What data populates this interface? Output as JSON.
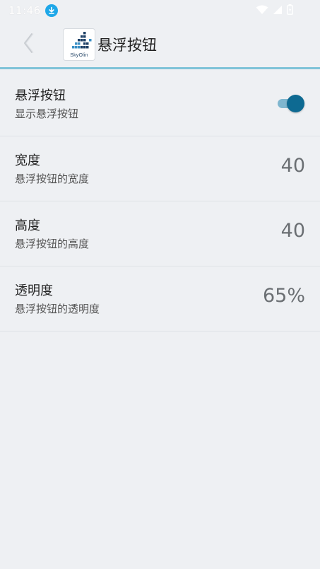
{
  "status_bar": {
    "time": "11:46",
    "icons": [
      "download-icon",
      "wifi-icon",
      "signal-icon",
      "battery-icon"
    ]
  },
  "header": {
    "title": "悬浮按钮",
    "logo_text": "SkyOlin",
    "back_icon": "chevron-left-icon"
  },
  "colors": {
    "accent": "#0e6a92",
    "accent_light": "#7fb6cf",
    "header_border": "#7fc3d8",
    "background": "#eef0f3"
  },
  "settings": [
    {
      "title": "悬浮按钮",
      "summary": "显示悬浮按钮",
      "enabled": true
    },
    {
      "title": "宽度",
      "summary": "悬浮按钮的宽度",
      "value": "40"
    },
    {
      "title": "高度",
      "summary": "悬浮按钮的高度",
      "value": "40"
    },
    {
      "title": "透明度",
      "summary": "悬浮按钮的透明度",
      "value": "65%"
    }
  ]
}
